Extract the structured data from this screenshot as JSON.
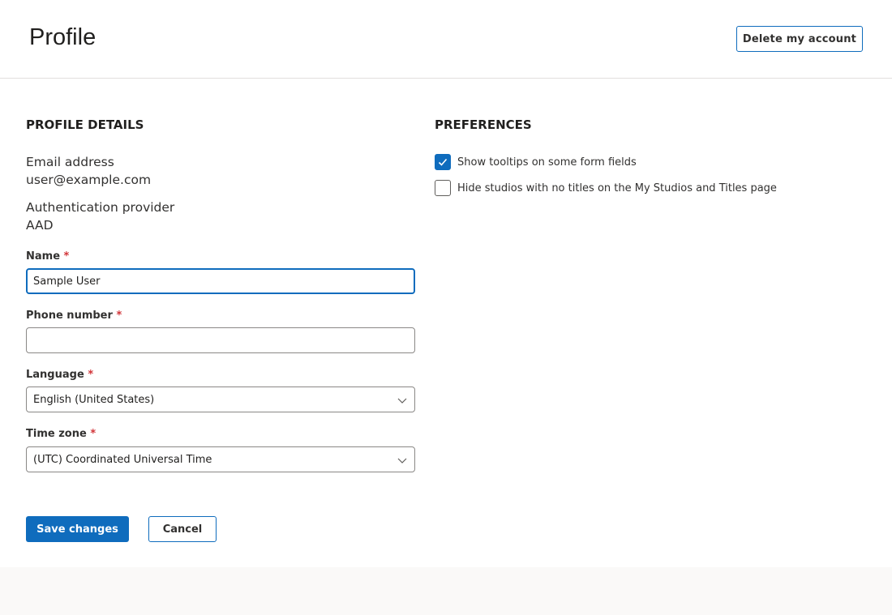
{
  "header": {
    "title": "Profile",
    "delete_label": "Delete my account"
  },
  "profile_details": {
    "heading": "PROFILE DETAILS",
    "email_label": "Email address",
    "email_value": "user@example.com",
    "auth_label": "Authentication provider",
    "auth_value": "AAD",
    "name": {
      "label": "Name",
      "required": "*",
      "value": "Sample User"
    },
    "phone": {
      "label": "Phone number",
      "required": "*",
      "value": ""
    },
    "language": {
      "label": "Language",
      "required": "*",
      "value": "English (United States)"
    },
    "timezone": {
      "label": "Time zone",
      "required": "*",
      "value": "(UTC) Coordinated Universal Time"
    }
  },
  "preferences": {
    "heading": "PREFERENCES",
    "options": [
      {
        "label": "Show tooltips on some form fields",
        "checked": true
      },
      {
        "label": "Hide studios with no titles on the My Studios and Titles page",
        "checked": false
      }
    ]
  },
  "actions": {
    "save_label": "Save changes",
    "cancel_label": "Cancel"
  },
  "colors": {
    "accent": "#0f6cbd",
    "required": "#d13438"
  }
}
